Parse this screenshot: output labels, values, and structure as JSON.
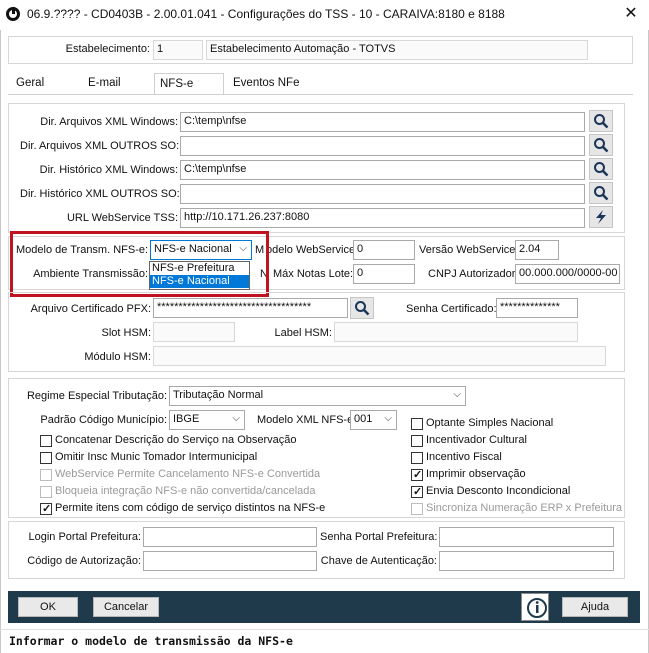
{
  "window": {
    "title": "06.9.???? - CD0403B - 2.00.01.041 - Configurações do TSS - 10 - CARAIVA:8180 e 8188"
  },
  "estabelecimento": {
    "label": "Estabelecimento:",
    "code": "1",
    "name": "Estabelecimento Automação - TOTVS"
  },
  "tabs": [
    {
      "label": "Geral"
    },
    {
      "label": "E-mail"
    },
    {
      "label": "NFS-e"
    },
    {
      "label": "Eventos NFe"
    }
  ],
  "dirs": {
    "xml_windows_label": "Dir. Arquivos XML Windows:",
    "xml_windows_value": "C:\\temp\\nfse",
    "xml_outros_label": "Dir. Arquivos XML OUTROS SO:",
    "xml_outros_value": "",
    "hist_windows_label": "Dir. Histórico XML Windows:",
    "hist_windows_value": "C:\\temp\\nfse",
    "hist_outros_label": "Dir. Histórico XML OUTROS SO:",
    "hist_outros_value": "",
    "url_label": "URL WebService TSS:",
    "url_value": "http://10.171.26.237:8080"
  },
  "transmissao": {
    "modelo_label": "Modelo de Transm. NFS-e:",
    "modelo_value": "NFS-e Nacional",
    "options": [
      "NFS-e Prefeitura",
      "NFS-e Nacional"
    ],
    "ambiente_label": "Ambiente Transmissão:",
    "modelo_ws_label_a": "M",
    "modelo_ws_label_b": "odelo WebService:",
    "modelo_ws_value": "0",
    "versao_ws_label": "Versão WebService:",
    "versao_ws_value": "2.04",
    "max_notas_label_a": "N",
    "max_notas_label_b": "Máx Notas Lote:",
    "max_notas_value": "0",
    "cnpj_label": "CNPJ Autorizador:",
    "cnpj_value": "00.000.000/0000-00"
  },
  "certificado": {
    "pfx_label": "Arquivo Certificado PFX:",
    "pfx_value": "************************************",
    "senha_label": "Senha Certificado:",
    "senha_value": "**************",
    "slot_label": "Slot HSM:",
    "slot_value": "",
    "label_hsm_label": "Label HSM:",
    "label_hsm_value": "",
    "modulo_label": "Módulo HSM:",
    "modulo_value": ""
  },
  "regime": {
    "label": "Regime Especial Tributação:",
    "value": "Tributação Normal",
    "padrao_label": "Padrão Código Município:",
    "padrao_value": "IBGE",
    "modelo_xml_label": "Modelo XML NFS-e:",
    "modelo_xml_value": "001"
  },
  "checks_left": [
    {
      "label": "Concatenar Descrição do Serviço na Observação",
      "checked": false,
      "disabled": false
    },
    {
      "label": "Omitir Insc Munic Tomador Intermunicipal",
      "checked": false,
      "disabled": false
    },
    {
      "label": "WebService Permite Cancelamento NFS-e Convertida",
      "checked": false,
      "disabled": true
    },
    {
      "label": "Bloqueia integração NFS-e não convertida/cancelada",
      "checked": false,
      "disabled": true
    },
    {
      "label": "Permite itens com código de serviço distintos na NFS-e",
      "checked": true,
      "disabled": false
    }
  ],
  "checks_right": [
    {
      "label": "Optante Simples Nacional",
      "checked": false,
      "disabled": false
    },
    {
      "label": "Incentivador Cultural",
      "checked": false,
      "disabled": false
    },
    {
      "label": "Incentivo Fiscal",
      "checked": false,
      "disabled": false
    },
    {
      "label": "Imprimir observação",
      "checked": true,
      "disabled": false
    },
    {
      "label": "Envia Desconto Incondicional",
      "checked": true,
      "disabled": false
    },
    {
      "label": "Sincroniza Numeração ERP x Prefeitura",
      "checked": false,
      "disabled": true
    }
  ],
  "portal": {
    "login_label": "Login Portal Prefeitura:",
    "login_value": "",
    "senha_label": "Senha Portal Prefeitura:",
    "senha_value": "",
    "cod_label": "Código de Autorização:",
    "cod_value": "",
    "chave_label": "Chave de Autenticação:",
    "chave_value": ""
  },
  "buttons": {
    "ok": "OK",
    "cancelar": "Cancelar",
    "ajuda": "Ajuda"
  },
  "status": "Informar o modelo de transmissão da NFS-e",
  "colors": {
    "bottombar": "#1f3a4b",
    "highlight": "#c1121f",
    "selection": "#0078d7"
  }
}
